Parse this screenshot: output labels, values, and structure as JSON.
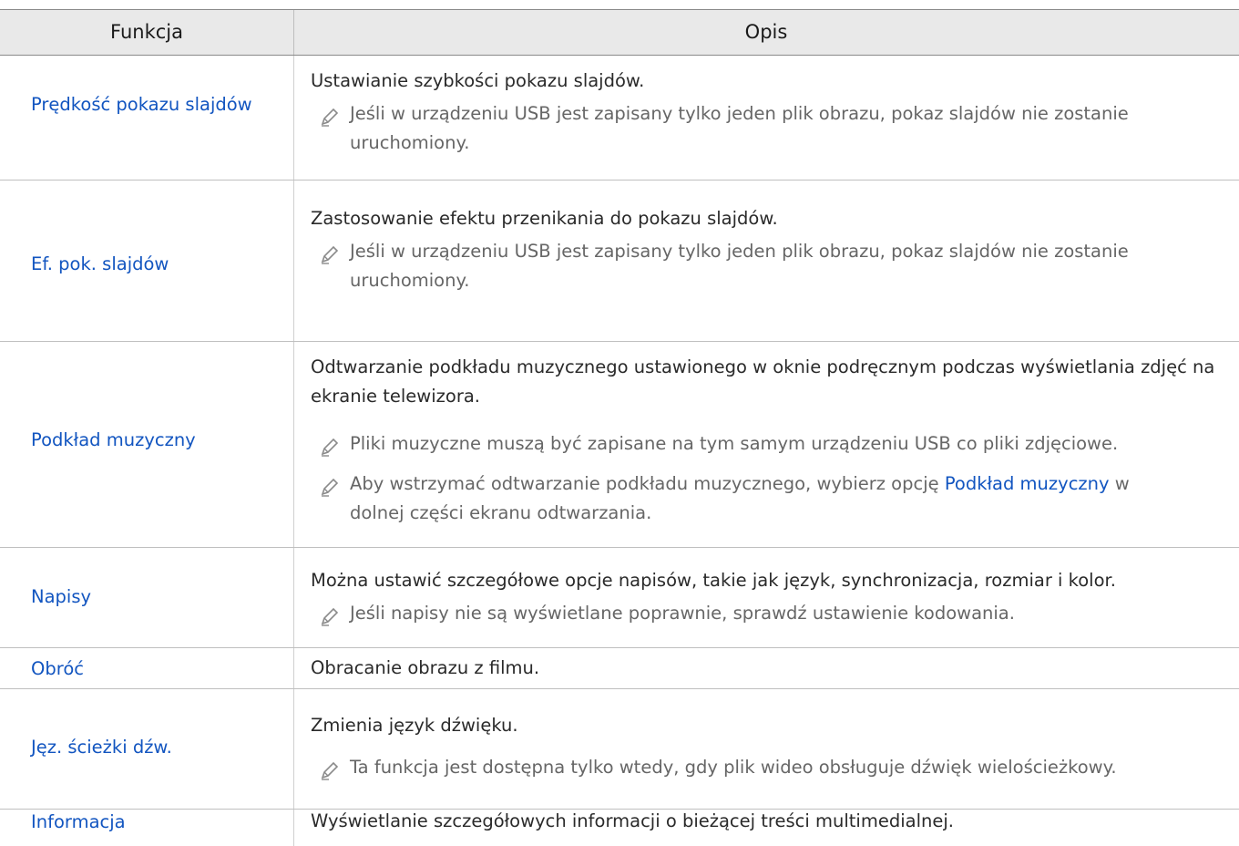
{
  "header": {
    "col_function": "Funkcja",
    "col_description": "Opis"
  },
  "rows": [
    {
      "function": "Prędkość pokazu slajdów",
      "description": "Ustawianie szybkości pokazu slajdów.",
      "notes": [
        "Jeśli w urządzeniu USB jest zapisany tylko jeden plik obrazu, pokaz slajdów nie zostanie uruchomiony."
      ]
    },
    {
      "function": "Ef. pok. slajdów",
      "description": "Zastosowanie efektu przenikania do pokazu slajdów.",
      "notes": [
        "Jeśli w urządzeniu USB jest zapisany tylko jeden plik obrazu, pokaz slajdów nie zostanie uruchomiony."
      ]
    },
    {
      "function": "Podkład muzyczny",
      "description": "Odtwarzanie podkładu muzycznego ustawionego w oknie podręcznym podczas wyświetlania zdjęć na ekranie telewizora.",
      "notes": [
        "Pliki muzyczne muszą być zapisane na tym samym urządzeniu USB co pliki zdjęciowe.",
        {
          "before": "Aby wstrzymać odtwarzanie podkładu muzycznego, wybierz opcję ",
          "link": "Podkład muzyczny",
          "after": " w dolnej części ekranu odtwarzania."
        }
      ]
    },
    {
      "function": "Napisy",
      "description": "Można ustawić szczegółowe opcje napisów, takie jak język, synchronizacja, rozmiar i kolor.",
      "notes": [
        "Jeśli napisy nie są wyświetlane poprawnie, sprawdź ustawienie kodowania."
      ]
    },
    {
      "function": "Obróć",
      "description": "Obracanie obrazu z filmu.",
      "notes": []
    },
    {
      "function": "Jęz. ścieżki dźw.",
      "description": "Zmienia język dźwięku.",
      "notes": [
        "Ta funkcja jest dostępna tylko wtedy, gdy plik wideo obsługuje dźwięk wielościeżkowy."
      ]
    },
    {
      "function": "Informacja",
      "description": "Wyświetlanie szczegółowych informacji o bieżącej treści multimedialnej.",
      "notes": []
    }
  ],
  "icons": {
    "note_icon": "pencil-icon"
  },
  "colors": {
    "link": "#1255c0",
    "header_bg": "#e9e9e9",
    "note_text": "#666666"
  }
}
